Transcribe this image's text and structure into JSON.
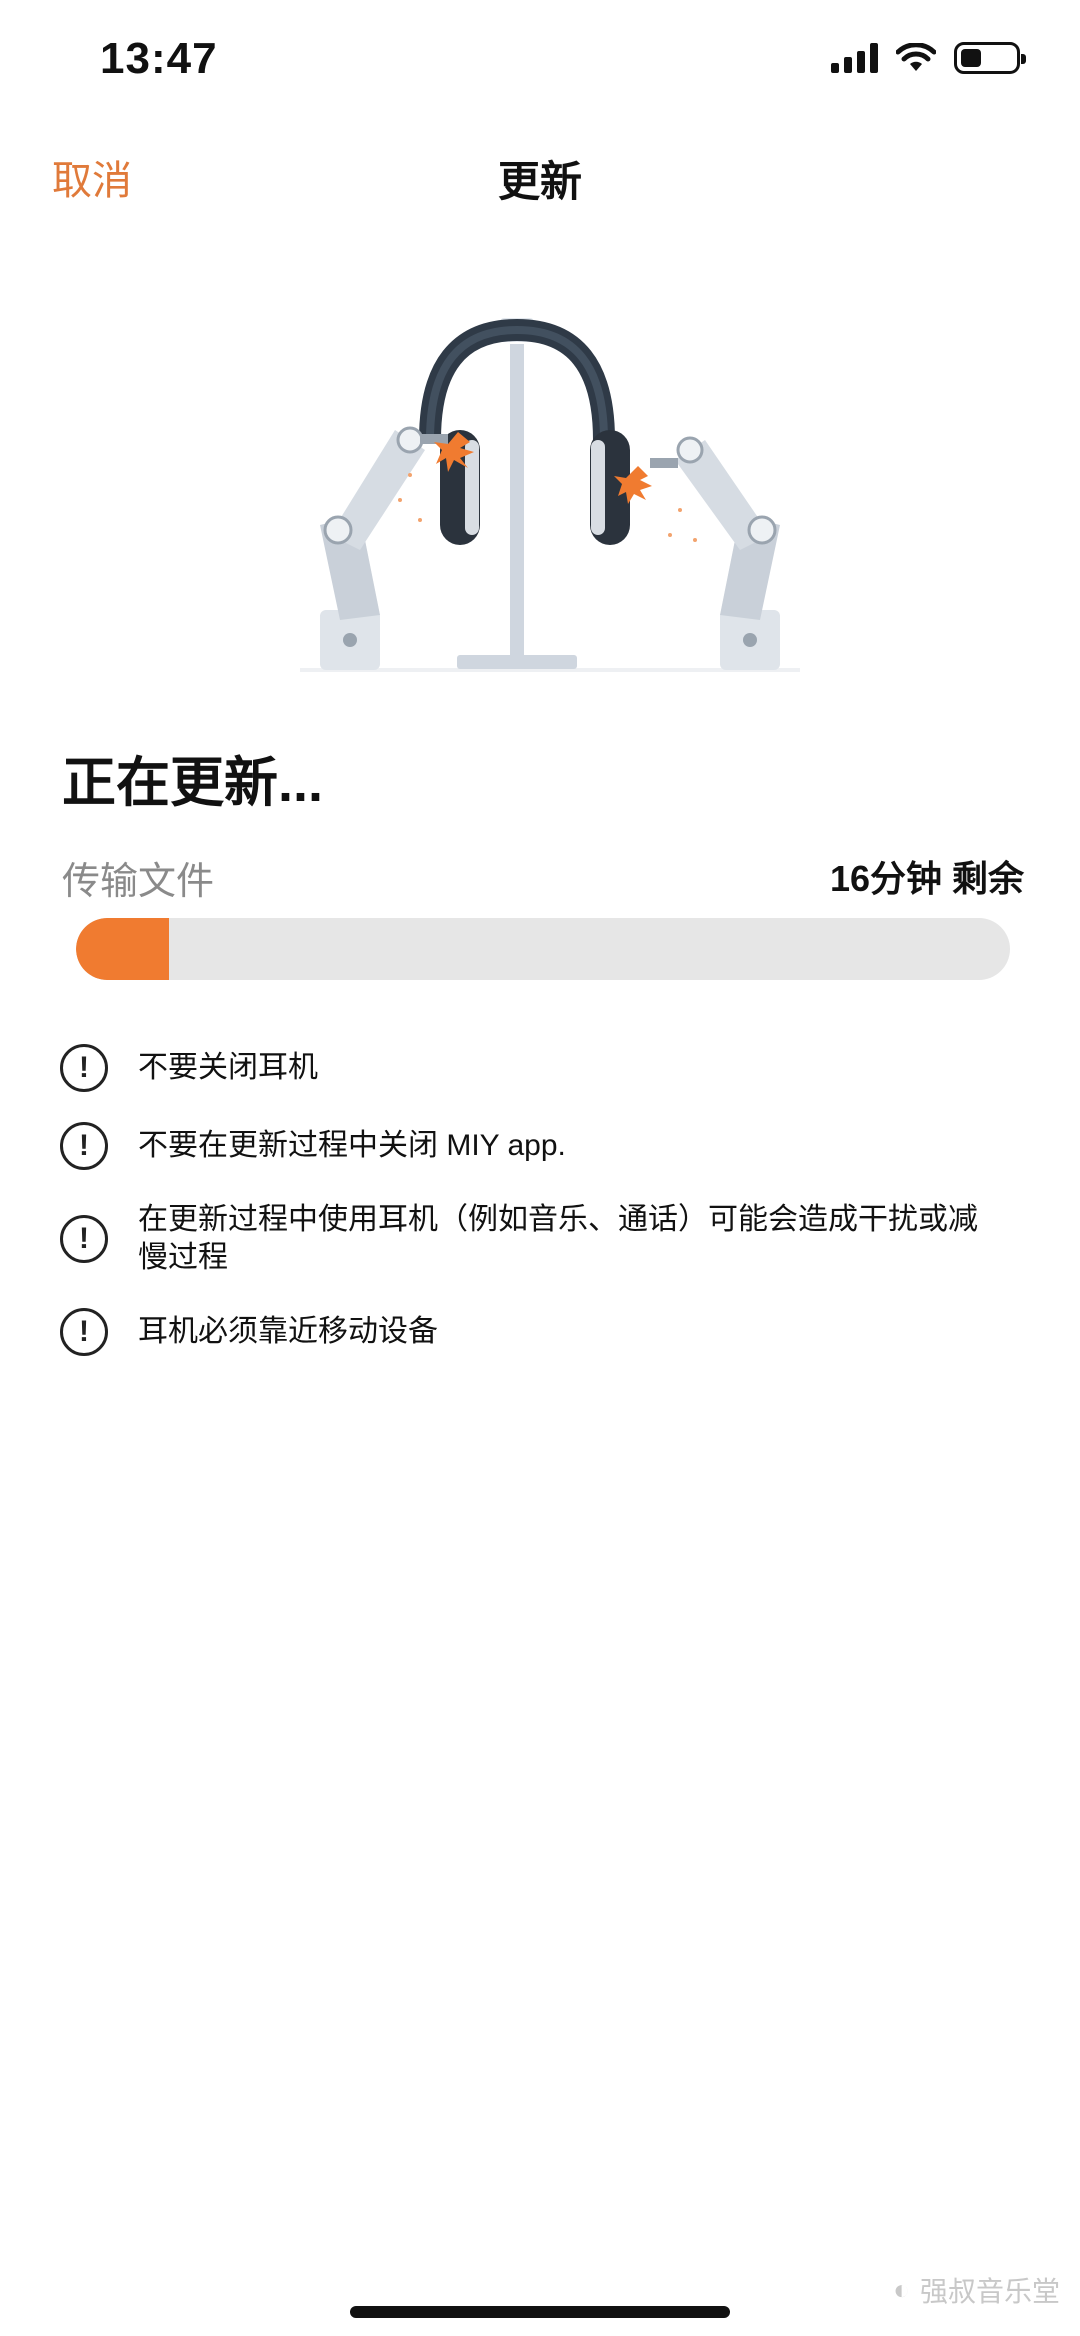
{
  "status_bar": {
    "time": "13:47"
  },
  "nav": {
    "cancel_label": "取消",
    "title": "更新"
  },
  "main": {
    "heading": "正在更新...",
    "transfer_label": "传输文件",
    "time_remaining": "16分钟 剩余",
    "progress_percent": 10
  },
  "warnings": [
    "不要关闭耳机",
    "不要在更新过程中关闭 MIY app.",
    "在更新过程中使用耳机（例如音乐、通话）可能会造成干扰或减慢过程",
    "耳机必须靠近移动设备"
  ],
  "warning_icon_glyph": "!",
  "watermark": {
    "text": "强叔音乐堂",
    "icon": "wechat-icon"
  },
  "colors": {
    "accent": "#f07b30",
    "cancel": "#e07a3a",
    "track": "#e6e6e6"
  },
  "icons": [
    "cellular-signal-icon",
    "wifi-icon",
    "battery-icon",
    "headphones-robot-illustration",
    "warning-icon"
  ]
}
